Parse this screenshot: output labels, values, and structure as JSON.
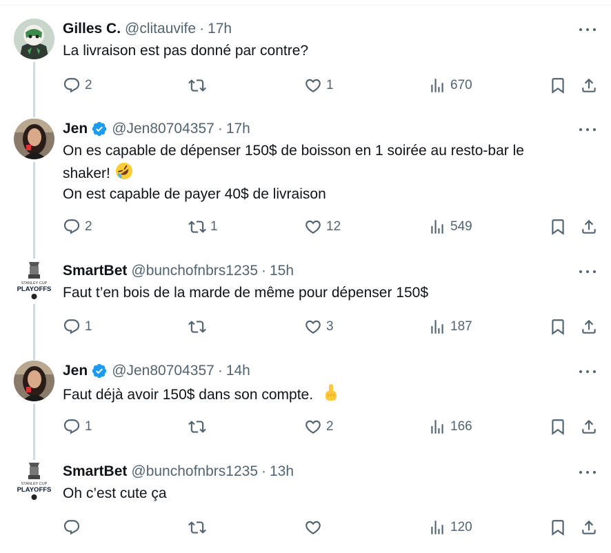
{
  "tweets": [
    {
      "name": "Gilles C.",
      "verified": false,
      "handle": "@clitauvife",
      "separator": "·",
      "time": "17h",
      "lines": [
        "La livraison est pas donné par contre?"
      ],
      "emoji": "",
      "replies": "2",
      "retweets": "",
      "likes": "1",
      "views": "670"
    },
    {
      "name": "Jen",
      "verified": true,
      "handle": "@Jen80704357",
      "separator": "·",
      "time": "17h",
      "lines": [
        "On es capable de dépenser 150$ de boisson en 1 soirée au resto-bar le",
        "shaker!",
        "On est capable de payer 40$ de livraison"
      ],
      "emoji": "rolling-on-floor-laughing-emoji",
      "replies": "2",
      "retweets": "1",
      "likes": "12",
      "views": "549"
    },
    {
      "name": "SmartBet",
      "verified": false,
      "handle": "@bunchofnbrs1235",
      "separator": "·",
      "time": "15h",
      "lines": [
        "Faut t’en bois de la marde de même pour dépenser 150$"
      ],
      "emoji": "",
      "replies": "1",
      "retweets": "",
      "likes": "3",
      "views": "187"
    },
    {
      "name": "Jen",
      "verified": true,
      "handle": "@Jen80704357",
      "separator": "·",
      "time": "14h",
      "lines": [
        "Faut déjà avoir 150$ dans son compte."
      ],
      "emoji": "middle-finger-emoji",
      "replies": "1",
      "retweets": "",
      "likes": "2",
      "views": "166"
    },
    {
      "name": "SmartBet",
      "verified": false,
      "handle": "@bunchofnbrs1235",
      "separator": "·",
      "time": "13h",
      "lines": [
        "Oh c’est cute ça"
      ],
      "emoji": "",
      "replies": "",
      "retweets": "",
      "likes": "",
      "views": "120"
    }
  ],
  "avatar_logo": {
    "line1": "STANLEY CUP",
    "line2": "PLAYOFFS"
  },
  "colors": {
    "verified_blue": "#1d9bf0",
    "muted_text": "#536471",
    "thread_line": "#cfd9de"
  }
}
